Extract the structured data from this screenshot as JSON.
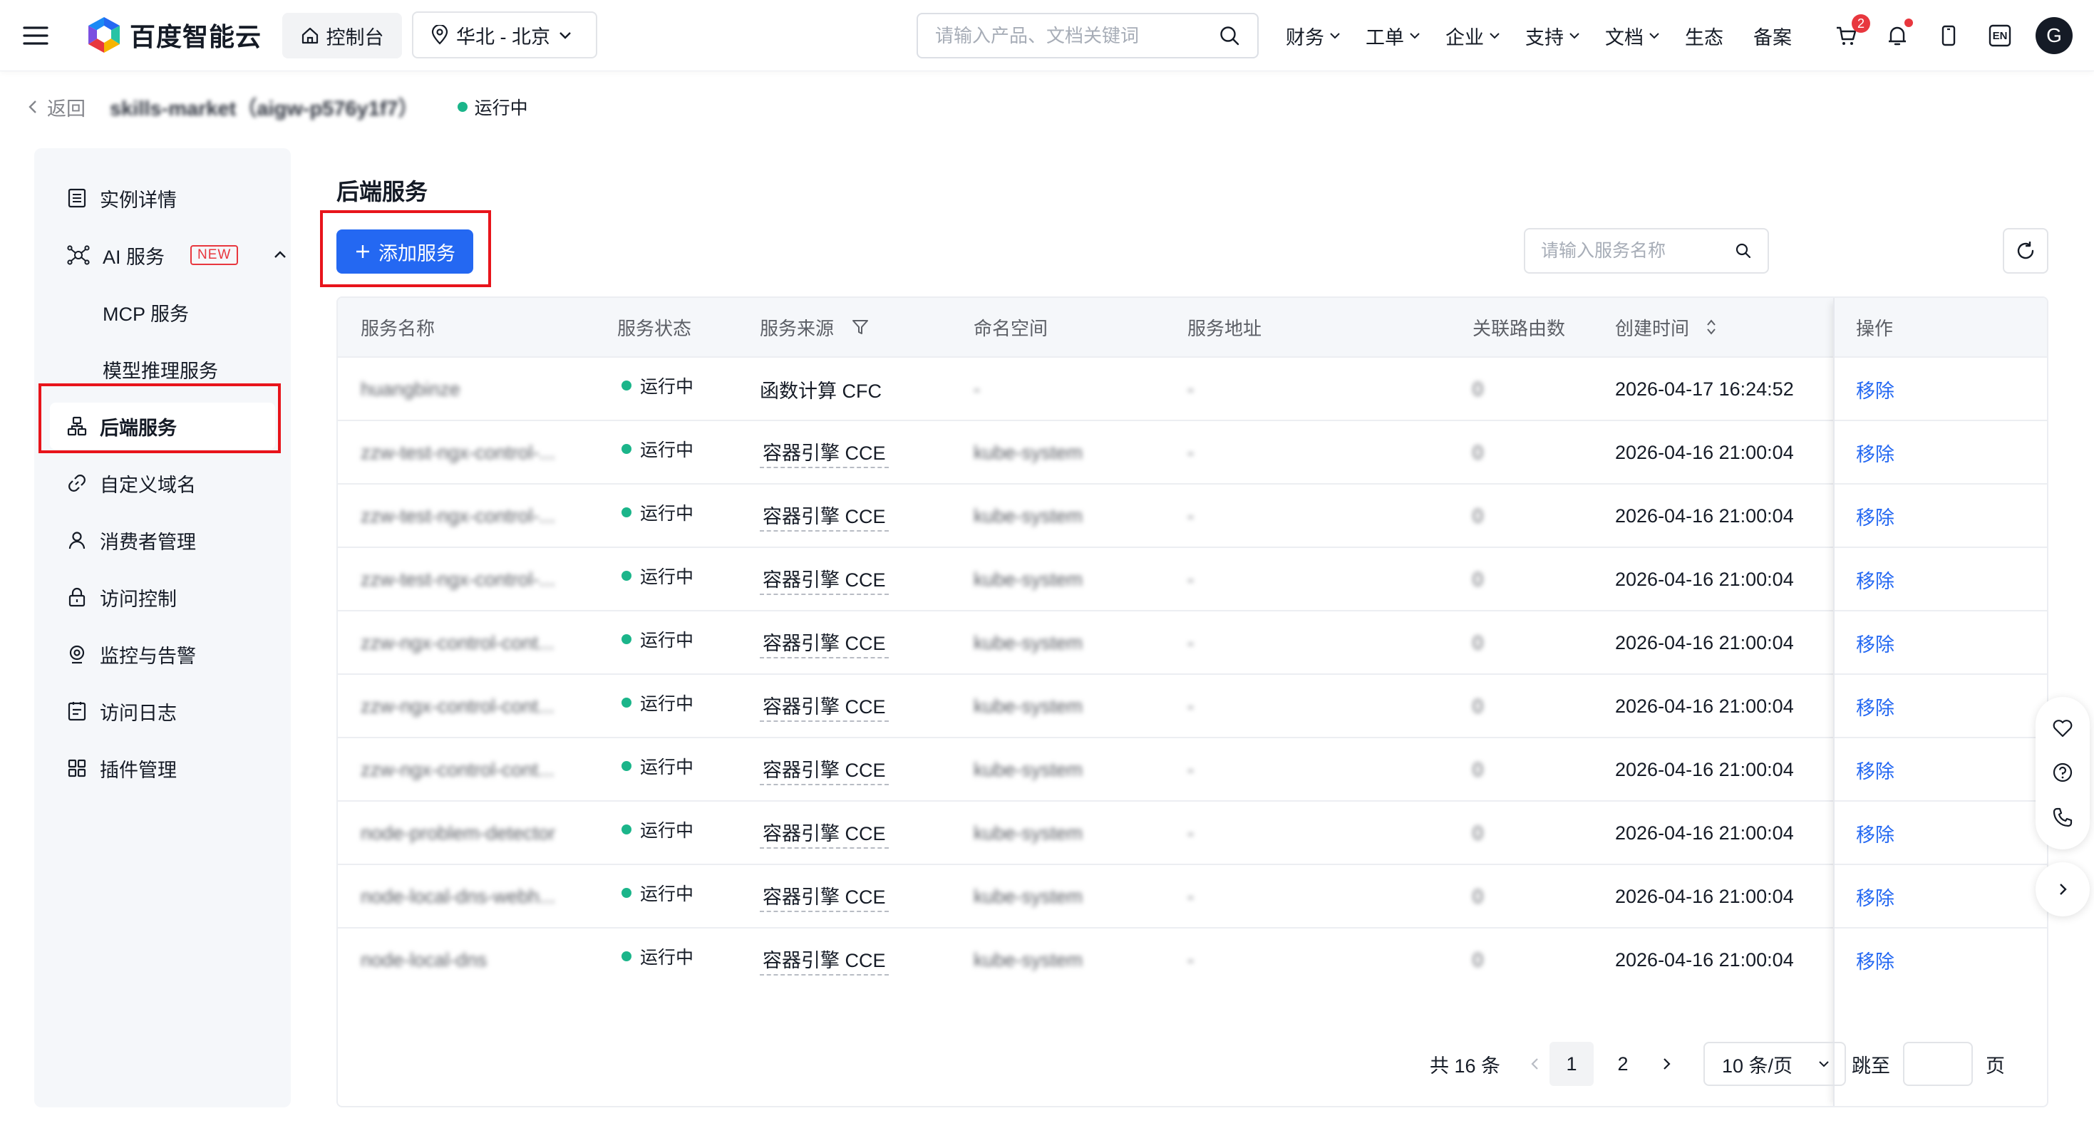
{
  "topbar": {
    "brand": "百度智能云",
    "console": "控制台",
    "region": "华北 - 北京",
    "search_placeholder": "请输入产品、文档关键词",
    "nav": [
      {
        "label": "财务",
        "has_menu": true
      },
      {
        "label": "工单",
        "has_menu": true
      },
      {
        "label": "企业",
        "has_menu": true
      },
      {
        "label": "支持",
        "has_menu": true
      },
      {
        "label": "文档",
        "has_menu": true
      },
      {
        "label": "生态",
        "has_menu": false
      },
      {
        "label": "备案",
        "has_menu": false
      }
    ],
    "cart_badge": "2",
    "lang": "EN",
    "avatar": "G"
  },
  "header": {
    "back": "返回",
    "instance": "skills-market（aigw-p576y1f7）",
    "status": "运行中"
  },
  "sidebar": {
    "items": [
      {
        "label": "实例详情",
        "icon": "list-icon"
      },
      {
        "label": "AI 服务",
        "icon": "ai-network-icon",
        "tag": "NEW"
      },
      {
        "label": "MCP 服务"
      },
      {
        "label": "模型推理服务"
      },
      {
        "label": "后端服务",
        "icon": "hierarchy-icon",
        "active": true
      },
      {
        "label": "自定义域名",
        "icon": "link-icon"
      },
      {
        "label": "消费者管理",
        "icon": "user-icon"
      },
      {
        "label": "访问控制",
        "icon": "lock-icon"
      },
      {
        "label": "监控与告警",
        "icon": "monitor-icon"
      },
      {
        "label": "访问日志",
        "icon": "log-icon"
      },
      {
        "label": "插件管理",
        "icon": "grid-icon"
      }
    ]
  },
  "main": {
    "title": "后端服务",
    "add_button": "添加服务",
    "search_placeholder": "请输入服务名称",
    "columns": [
      "服务名称",
      "服务状态",
      "服务来源",
      "命名空间",
      "服务地址",
      "关联路由数",
      "创建时间",
      "操作"
    ],
    "rows": [
      {
        "name": "huangbinze",
        "status": "运行中",
        "source": "函数计算 CFC",
        "source_dashed": false,
        "namespace": "-",
        "address": "-",
        "routes": "0",
        "created": "2026-04-17 16:24:52",
        "action": "移除"
      },
      {
        "name": "zzw-test-ngx-control-...",
        "status": "运行中",
        "source": "容器引擎 CCE",
        "source_dashed": true,
        "namespace": "kube-system",
        "address": "-",
        "routes": "0",
        "created": "2026-04-16 21:00:04",
        "action": "移除"
      },
      {
        "name": "zzw-test-ngx-control-...",
        "status": "运行中",
        "source": "容器引擎 CCE",
        "source_dashed": true,
        "namespace": "kube-system",
        "address": "-",
        "routes": "0",
        "created": "2026-04-16 21:00:04",
        "action": "移除"
      },
      {
        "name": "zzw-test-ngx-control-...",
        "status": "运行中",
        "source": "容器引擎 CCE",
        "source_dashed": true,
        "namespace": "kube-system",
        "address": "-",
        "routes": "0",
        "created": "2026-04-16 21:00:04",
        "action": "移除"
      },
      {
        "name": "zzw-ngx-control-cont...",
        "status": "运行中",
        "source": "容器引擎 CCE",
        "source_dashed": true,
        "namespace": "kube-system",
        "address": "-",
        "routes": "0",
        "created": "2026-04-16 21:00:04",
        "action": "移除"
      },
      {
        "name": "zzw-ngx-control-cont...",
        "status": "运行中",
        "source": "容器引擎 CCE",
        "source_dashed": true,
        "namespace": "kube-system",
        "address": "-",
        "routes": "0",
        "created": "2026-04-16 21:00:04",
        "action": "移除"
      },
      {
        "name": "zzw-ngx-control-cont...",
        "status": "运行中",
        "source": "容器引擎 CCE",
        "source_dashed": true,
        "namespace": "kube-system",
        "address": "-",
        "routes": "0",
        "created": "2026-04-16 21:00:04",
        "action": "移除"
      },
      {
        "name": "node-problem-detector",
        "status": "运行中",
        "source": "容器引擎 CCE",
        "source_dashed": true,
        "namespace": "kube-system",
        "address": "-",
        "routes": "0",
        "created": "2026-04-16 21:00:04",
        "action": "移除"
      },
      {
        "name": "node-local-dns-webh...",
        "status": "运行中",
        "source": "容器引擎 CCE",
        "source_dashed": true,
        "namespace": "kube-system",
        "address": "-",
        "routes": "0",
        "created": "2026-04-16 21:00:04",
        "action": "移除"
      },
      {
        "name": "node-local-dns",
        "status": "运行中",
        "source": "容器引擎 CCE",
        "source_dashed": true,
        "namespace": "kube-system",
        "address": "-",
        "routes": "0",
        "created": "2026-04-16 21:00:04",
        "action": "移除"
      }
    ],
    "pagination": {
      "total": "共 16 条",
      "pages": [
        "1",
        "2"
      ],
      "current": "1",
      "page_size": "10 条/页",
      "jump_label": "跳至",
      "page_suffix": "页"
    }
  },
  "colors": {
    "primary": "#2468f2",
    "running": "#1bb58a",
    "highlight": "#e8141b",
    "danger": "#e8373e"
  }
}
